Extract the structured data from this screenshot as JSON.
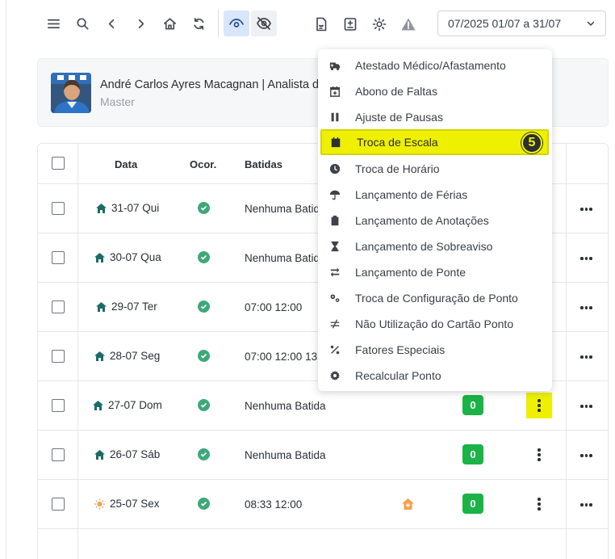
{
  "period": {
    "value": "07/2025  01/07 a 31/07"
  },
  "user": {
    "name": "André Carlos Ayres Macagnan | Analista d",
    "role": "Master"
  },
  "table": {
    "headers": {
      "date": "Data",
      "occurrences": "Ocor.",
      "punches": "Batidas"
    },
    "rows": [
      {
        "date": "31-07 Qui",
        "icon": "home-icon",
        "punches": "Nenhuma Batid",
        "badge": "",
        "status": "check-icon"
      },
      {
        "date": "30-07 Qua",
        "icon": "home-icon",
        "punches": "Nenhuma Batid",
        "badge": "",
        "status": "check-icon"
      },
      {
        "date": "29-07 Ter",
        "icon": "home-icon",
        "punches": "07:00 12:00",
        "badge": "",
        "status": "check-icon"
      },
      {
        "date": "28-07 Seg",
        "icon": "home-icon",
        "punches": "07:00 12:00 13",
        "badge": "",
        "status": "check-icon"
      },
      {
        "date": "27-07 Dom",
        "icon": "home-icon",
        "punches": "Nenhuma Batida",
        "badge": "0",
        "status": "check-icon"
      },
      {
        "date": "26-07 Sáb",
        "icon": "home-icon",
        "punches": "Nenhuma Batida",
        "badge": "0",
        "status": "check-icon"
      },
      {
        "date": "25-07 Sex",
        "icon": "sun-icon",
        "punches": "08:33 12:00",
        "badge": "0",
        "status": "check-icon"
      }
    ]
  },
  "menu": {
    "items": [
      {
        "label": "Atestado Médico/Afastamento",
        "icon": "ambulance-icon"
      },
      {
        "label": "Abono de Faltas",
        "icon": "calendar-plus-icon"
      },
      {
        "label": "Ajuste de Pausas",
        "icon": "pause-icon"
      },
      {
        "label": "Troca de Escala",
        "icon": "calendar-icon"
      },
      {
        "label": "Troca de Horário",
        "icon": "clock-icon"
      },
      {
        "label": "Lançamento de Férias",
        "icon": "umbrella-icon"
      },
      {
        "label": "Lançamento de Anotações",
        "icon": "clipboard-icon"
      },
      {
        "label": "Lançamento de Sobreaviso",
        "icon": "hourglass-icon"
      },
      {
        "label": "Lançamento de Ponte",
        "icon": "swap-icon"
      },
      {
        "label": "Troca de Configuração de Ponto",
        "icon": "gears-icon"
      },
      {
        "label": "Não Utilização do Cartão Ponto",
        "icon": "not-equal-icon"
      },
      {
        "label": "Fatores Especiais",
        "icon": "percent-icon"
      },
      {
        "label": "Recalcular Ponto",
        "icon": "gear-icon"
      }
    ],
    "step_marker": "5"
  },
  "colors": {
    "highlight": "#eef000",
    "success": "#1bb345",
    "check": "#3fa87a",
    "accent_blue": "#d8e6fb",
    "warning_orange": "#f5a04a"
  }
}
